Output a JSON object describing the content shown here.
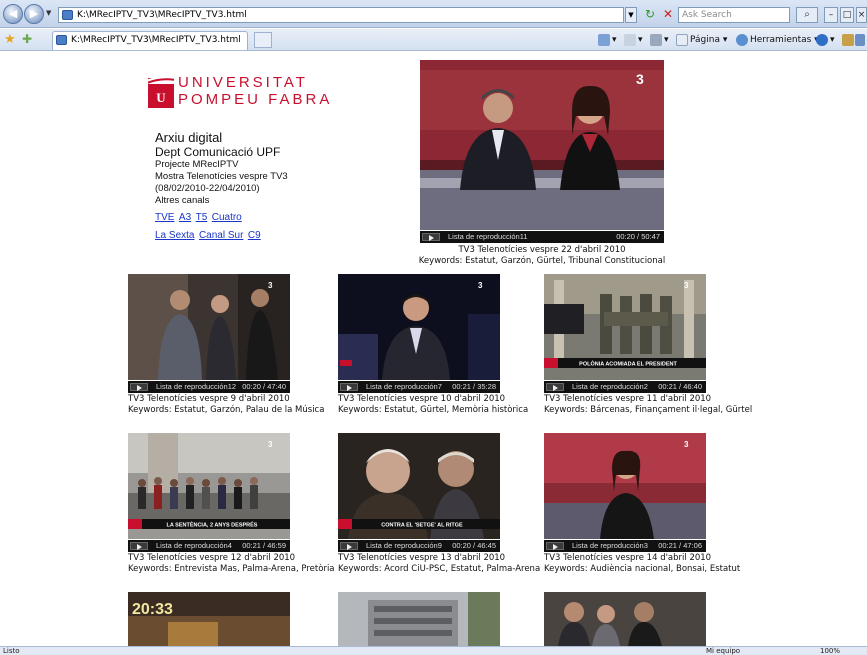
{
  "browser": {
    "address": "K:\\MRecIPTV_TV3\\MRecIPTV_TV3.html",
    "search_placeholder": "Ask Search",
    "tab_title": "K:\\MRecIPTV_TV3\\MRecIPTV_TV3.html",
    "cmd_page": "Página",
    "cmd_tools": "Herramientas",
    "status_text": "Listo",
    "status_zone": "Mi equipo",
    "zoom": "100%"
  },
  "logo": {
    "line1": "UNIVERSITAT",
    "line2": "POMPEU FABRA",
    "mark": "UPF",
    "brand_color": "#c8102e"
  },
  "info": {
    "title": "Arxiu digital",
    "dept": "Dept Comunicació UPF",
    "project": "Projecte MRecIPTV",
    "sample": "Mostra Telenotícies vespre TV3",
    "dates": "(08/02/2010-22/04/2010)",
    "other": "Altres canals",
    "channels_row1": [
      "TVE",
      "A3",
      "T5",
      "Cuatro"
    ],
    "channels_row2": [
      "La Sexta",
      "Canal Sur",
      "C9"
    ],
    "link_color": "#1a35c8"
  },
  "featured": {
    "playlist": "Lista de reproducción11",
    "time": "00:20 / 50:47",
    "title": "TV3 Telenotícies vespre 22 d'abril 2010",
    "keywords": "Keywords: Estatut, Garzón, Gürtel, Tribunal Constitucional"
  },
  "videos": [
    {
      "playlist": "Lista de reproducción12",
      "time": "00:20 / 47:40",
      "title": "TV3 Telenotícies vespre 9 d'abril 2010",
      "keywords": "Keywords: Estatut, Garzón, Palau de la Música"
    },
    {
      "playlist": "Lista de reproducción7",
      "time": "00:21 / 35:28",
      "title": "TV3 Telenotícies vespre 10 d'abril 2010",
      "keywords": "Keywords: Estatut, Gürtel, Memòria històrica"
    },
    {
      "playlist": "Lista de reproducción2",
      "time": "00:21 / 46:40",
      "title": "TV3 Telenotícies vespre 11 d'abril 2010",
      "keywords": "Keywords: Bárcenas, Finançament il·legal, Gürtel",
      "banner": "POLÒNIA ACOMIADA EL PRESIDENT"
    },
    {
      "playlist": "Lista de reproducción4",
      "time": "00:21 / 46:59",
      "title": "TV3 Telenotícies vespre 12 d'abril 2010",
      "keywords": "Keywords: Entrevista Mas, Palma-Arena, Pretòria",
      "banner": "LA SENTÈNCIA, 2 ANYS DESPRÉS"
    },
    {
      "playlist": "Lista de reproducción9",
      "time": "00:20 / 46:45",
      "title": "TV3 Telenotícies vespre 13 d'abril 2010",
      "keywords": "Keywords: Acord CiU-PSC, Estatut, Palma-Arena",
      "banner": "CONTRA EL 'SETGE' AL RITGE"
    },
    {
      "playlist": "Lista de reproducción3",
      "time": "00:21 / 47:06",
      "title": "TV3 Telenotícies vespre 14 d'abril 2010",
      "keywords": "Keywords: Audiència nacional, Bonsai, Estatut"
    }
  ],
  "partial_clock": "20:33"
}
